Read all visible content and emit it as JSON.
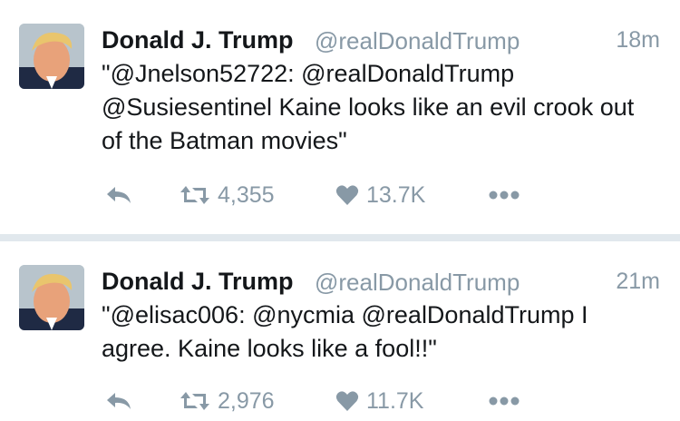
{
  "colors": {
    "name": "#14171a",
    "meta": "#8899a6",
    "divider": "#e1e8ed",
    "background": "#ffffff"
  },
  "tweets": [
    {
      "name": "Donald J. Trump",
      "handle": "@realDonaldTrump",
      "time": "18m",
      "text": "\"@Jnelson52722: @realDonaldTrump @Susiesentinel Kaine looks like an evil crook out of the Batman movies\"",
      "retweets": "4,355",
      "likes": "13.7K"
    },
    {
      "name": "Donald J. Trump",
      "handle": "@realDonaldTrump",
      "time": "21m",
      "text": "\"@elisac006: @nycmia @realDonaldTrump I agree. Kaine looks like a fool!!\"",
      "retweets": "2,976",
      "likes": "11.7K"
    }
  ],
  "icons": {
    "reply": "reply-icon",
    "retweet": "retweet-icon",
    "like": "heart-icon",
    "more": "more-dots-icon",
    "avatar": "profile-photo"
  }
}
